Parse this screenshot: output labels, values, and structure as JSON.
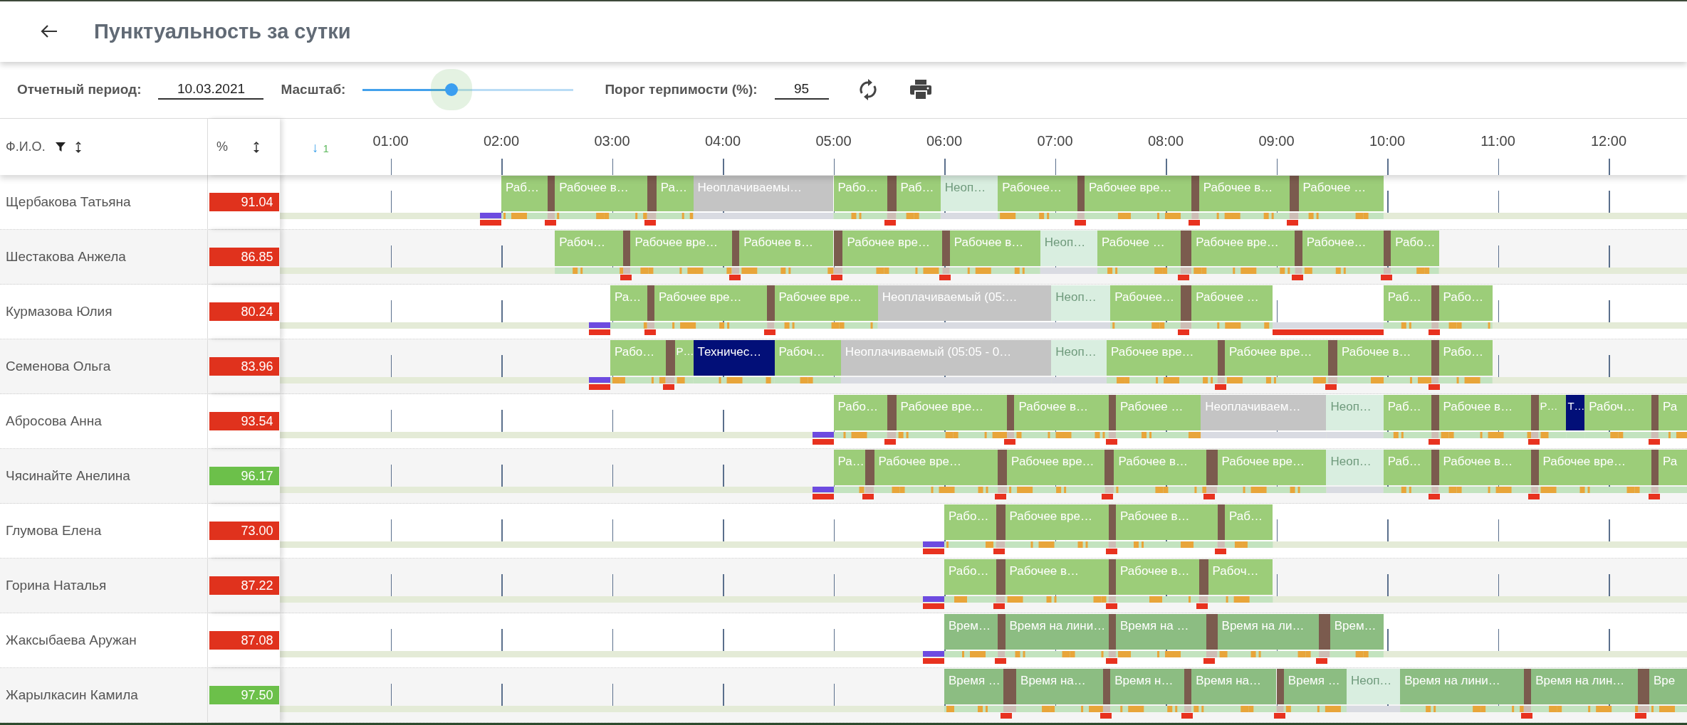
{
  "header": {
    "title": "Пунктуальность за сутки"
  },
  "toolbar": {
    "period_label": "Отчетный период:",
    "period_value": "10.03.2021",
    "scale_label": "Масштаб:",
    "scale": {
      "level": 0.42
    },
    "threshold_label": "Порог терпимости (%):",
    "threshold_value": "95"
  },
  "table": {
    "columns": [
      {
        "label": "Ф.И.О.",
        "filter": true
      },
      {
        "label": "%",
        "filter": false
      }
    ],
    "sort_marker": {
      "arrow": "↓",
      "count": "1"
    },
    "hours": [
      "01:00",
      "02:00",
      "03:00",
      "04:00",
      "05:00",
      "06:00",
      "07:00",
      "08:00",
      "09:00",
      "10:00",
      "11:00",
      "12:00"
    ],
    "rows": [
      {
        "name": "Щербакова Татьяна",
        "percent": "91.04",
        "color": "#e0321d",
        "late_start": true,
        "segments": [
          {
            "kind": "work",
            "label": "Раб…"
          },
          {
            "kind": "break"
          },
          {
            "kind": "work",
            "label": "Рабочее в…"
          },
          {
            "kind": "break"
          },
          {
            "kind": "work",
            "label": "Ра…"
          },
          {
            "kind": "unpaid",
            "label": "Неоплачиваемы…"
          },
          {
            "kind": "work",
            "label": "Рабо…"
          },
          {
            "kind": "break"
          },
          {
            "kind": "work",
            "label": "Раб…"
          },
          {
            "kind": "unpaid_light",
            "label": "Неоп…"
          },
          {
            "kind": "work",
            "label": "Рабочее…"
          },
          {
            "kind": "break"
          },
          {
            "kind": "work",
            "label": "Рабочее вре…"
          },
          {
            "kind": "break"
          },
          {
            "kind": "work",
            "label": "Рабочее в…"
          },
          {
            "kind": "break"
          },
          {
            "kind": "work",
            "label": "Рабочее …"
          }
        ]
      },
      {
        "name": "Шестакова Анжела",
        "percent": "86.85",
        "color": "#e0321d",
        "late_start": false,
        "segments": [
          {
            "kind": "work",
            "label": "Рабоч…"
          },
          {
            "kind": "break"
          },
          {
            "kind": "work",
            "label": "Рабочее вре…"
          },
          {
            "kind": "break"
          },
          {
            "kind": "work",
            "label": "Рабочее в…"
          },
          {
            "kind": "break"
          },
          {
            "kind": "work",
            "label": "Рабочее вре…"
          },
          {
            "kind": "break"
          },
          {
            "kind": "work",
            "label": "Рабочее в…"
          },
          {
            "kind": "unpaid_light",
            "label": "Неоп…"
          },
          {
            "kind": "work",
            "label": "Рабочее …"
          },
          {
            "kind": "break"
          },
          {
            "kind": "work",
            "label": "Рабочее вре…"
          },
          {
            "kind": "break"
          },
          {
            "kind": "work",
            "label": "Рабочее…"
          },
          {
            "kind": "break"
          },
          {
            "kind": "work",
            "label": "Рабо…"
          }
        ]
      },
      {
        "name": "Курмазова Юлия",
        "percent": "80.24",
        "color": "#e0321d",
        "late_start": true,
        "segments": [
          {
            "kind": "work",
            "label": "Ра…"
          },
          {
            "kind": "break"
          },
          {
            "kind": "work",
            "label": "Рабочее вре…"
          },
          {
            "kind": "break"
          },
          {
            "kind": "work",
            "label": "Рабочее вре…"
          },
          {
            "kind": "unpaid",
            "label": "Неоплачиваемый (05:…"
          },
          {
            "kind": "unpaid_light",
            "label": "Неоп…"
          },
          {
            "kind": "work",
            "label": "Рабочее…"
          },
          {
            "kind": "break"
          },
          {
            "kind": "work",
            "label": "Рабочее …"
          },
          {
            "kind": "absent"
          },
          {
            "kind": "work",
            "label": "Раб…"
          },
          {
            "kind": "break"
          },
          {
            "kind": "work",
            "label": "Рабо…"
          }
        ]
      },
      {
        "name": "Семенова Ольга",
        "percent": "83.96",
        "color": "#e0321d",
        "late_start": true,
        "segments": [
          {
            "kind": "work",
            "label": "Рабо…"
          },
          {
            "kind": "break"
          },
          {
            "kind": "work",
            "label": "Р…"
          },
          {
            "kind": "tech",
            "label": "Техничес…"
          },
          {
            "kind": "work",
            "label": "Рабоч…"
          },
          {
            "kind": "unpaid",
            "label": "Неоплачиваемый (05:05 - 0…"
          },
          {
            "kind": "unpaid_light",
            "label": "Неоп…"
          },
          {
            "kind": "work",
            "label": "Рабочее вре…"
          },
          {
            "kind": "break"
          },
          {
            "kind": "work",
            "label": "Рабочее вре…"
          },
          {
            "kind": "break"
          },
          {
            "kind": "work",
            "label": "Рабочее в…"
          },
          {
            "kind": "break"
          },
          {
            "kind": "work",
            "label": "Рабо…"
          }
        ]
      },
      {
        "name": "Абросова Анна",
        "percent": "93.54",
        "color": "#e0321d",
        "late_start": true,
        "segments": [
          {
            "kind": "work",
            "label": "Рабо…"
          },
          {
            "kind": "break"
          },
          {
            "kind": "work",
            "label": "Рабочее вре…"
          },
          {
            "kind": "break"
          },
          {
            "kind": "work",
            "label": "Рабочее в…"
          },
          {
            "kind": "break"
          },
          {
            "kind": "work",
            "label": "Рабочее …"
          },
          {
            "kind": "unpaid",
            "label": "Неоплачиваем…"
          },
          {
            "kind": "unpaid_light",
            "label": "Неоп…"
          },
          {
            "kind": "work",
            "label": "Раб…"
          },
          {
            "kind": "break"
          },
          {
            "kind": "work",
            "label": "Рабочее в…"
          },
          {
            "kind": "break"
          },
          {
            "kind": "work",
            "label": "Р…"
          },
          {
            "kind": "tech",
            "label": "Т…"
          },
          {
            "kind": "work",
            "label": "Рабоч…"
          },
          {
            "kind": "break"
          },
          {
            "kind": "work",
            "label": "Ра"
          }
        ]
      },
      {
        "name": "Чясинайте Анелина",
        "percent": "96.17",
        "color": "#6cc04a",
        "late_start": true,
        "segments": [
          {
            "kind": "work",
            "label": "Ра…"
          },
          {
            "kind": "break"
          },
          {
            "kind": "work",
            "label": "Рабочее вре…"
          },
          {
            "kind": "break"
          },
          {
            "kind": "work",
            "label": "Рабочее вре…"
          },
          {
            "kind": "break"
          },
          {
            "kind": "work",
            "label": "Рабочее в…"
          },
          {
            "kind": "break"
          },
          {
            "kind": "work",
            "label": "Рабочее вре…"
          },
          {
            "kind": "unpaid_light",
            "label": "Неоп…"
          },
          {
            "kind": "work",
            "label": "Раб…"
          },
          {
            "kind": "break"
          },
          {
            "kind": "work",
            "label": "Рабочее в…"
          },
          {
            "kind": "break"
          },
          {
            "kind": "work",
            "label": "Рабочее вре…"
          },
          {
            "kind": "break"
          },
          {
            "kind": "work",
            "label": "Ра"
          }
        ]
      },
      {
        "name": "Глумова Елена",
        "percent": "73.00",
        "color": "#e0321d",
        "late_start": true,
        "segments": [
          {
            "kind": "work",
            "label": "Рабо…"
          },
          {
            "kind": "break"
          },
          {
            "kind": "work",
            "label": "Рабочее вре…"
          },
          {
            "kind": "break"
          },
          {
            "kind": "work",
            "label": "Рабочее в…"
          },
          {
            "kind": "break"
          },
          {
            "kind": "work",
            "label": "Раб…"
          }
        ]
      },
      {
        "name": "Горина Наталья",
        "percent": "87.22",
        "color": "#e0321d",
        "late_start": true,
        "segments": [
          {
            "kind": "work",
            "label": "Рабо…"
          },
          {
            "kind": "break"
          },
          {
            "kind": "work",
            "label": "Рабочее в…"
          },
          {
            "kind": "break"
          },
          {
            "kind": "work",
            "label": "Рабочее в…"
          },
          {
            "kind": "break"
          },
          {
            "kind": "work",
            "label": "Рабоч…"
          }
        ]
      },
      {
        "name": "Жаксыбаева Аружан",
        "percent": "87.08",
        "color": "#e0321d",
        "late_start": true,
        "segments": [
          {
            "kind": "line",
            "label": "Врем…"
          },
          {
            "kind": "break"
          },
          {
            "kind": "line",
            "label": "Время на лини…"
          },
          {
            "kind": "break"
          },
          {
            "kind": "line",
            "label": "Время на …"
          },
          {
            "kind": "break"
          },
          {
            "kind": "line",
            "label": "Время на ли…"
          },
          {
            "kind": "break"
          },
          {
            "kind": "line",
            "label": "Врем…"
          }
        ]
      },
      {
        "name": "Жарылкасин Камила",
        "percent": "97.50",
        "color": "#6cc04a",
        "late_start": false,
        "segments": [
          {
            "kind": "line",
            "label": "Время …"
          },
          {
            "kind": "break"
          },
          {
            "kind": "line",
            "label": "Время на…"
          },
          {
            "kind": "break"
          },
          {
            "kind": "line",
            "label": "Время н…"
          },
          {
            "kind": "break"
          },
          {
            "kind": "line",
            "label": "Время на…"
          },
          {
            "kind": "break"
          },
          {
            "kind": "line",
            "label": "Время …"
          },
          {
            "kind": "unpaid_light",
            "label": "Неоп…"
          },
          {
            "kind": "line",
            "label": "Время на лини…"
          },
          {
            "kind": "break"
          },
          {
            "kind": "line",
            "label": "Время на лин…"
          },
          {
            "kind": "break"
          },
          {
            "kind": "line",
            "label": "Вре"
          }
        ]
      }
    ]
  }
}
